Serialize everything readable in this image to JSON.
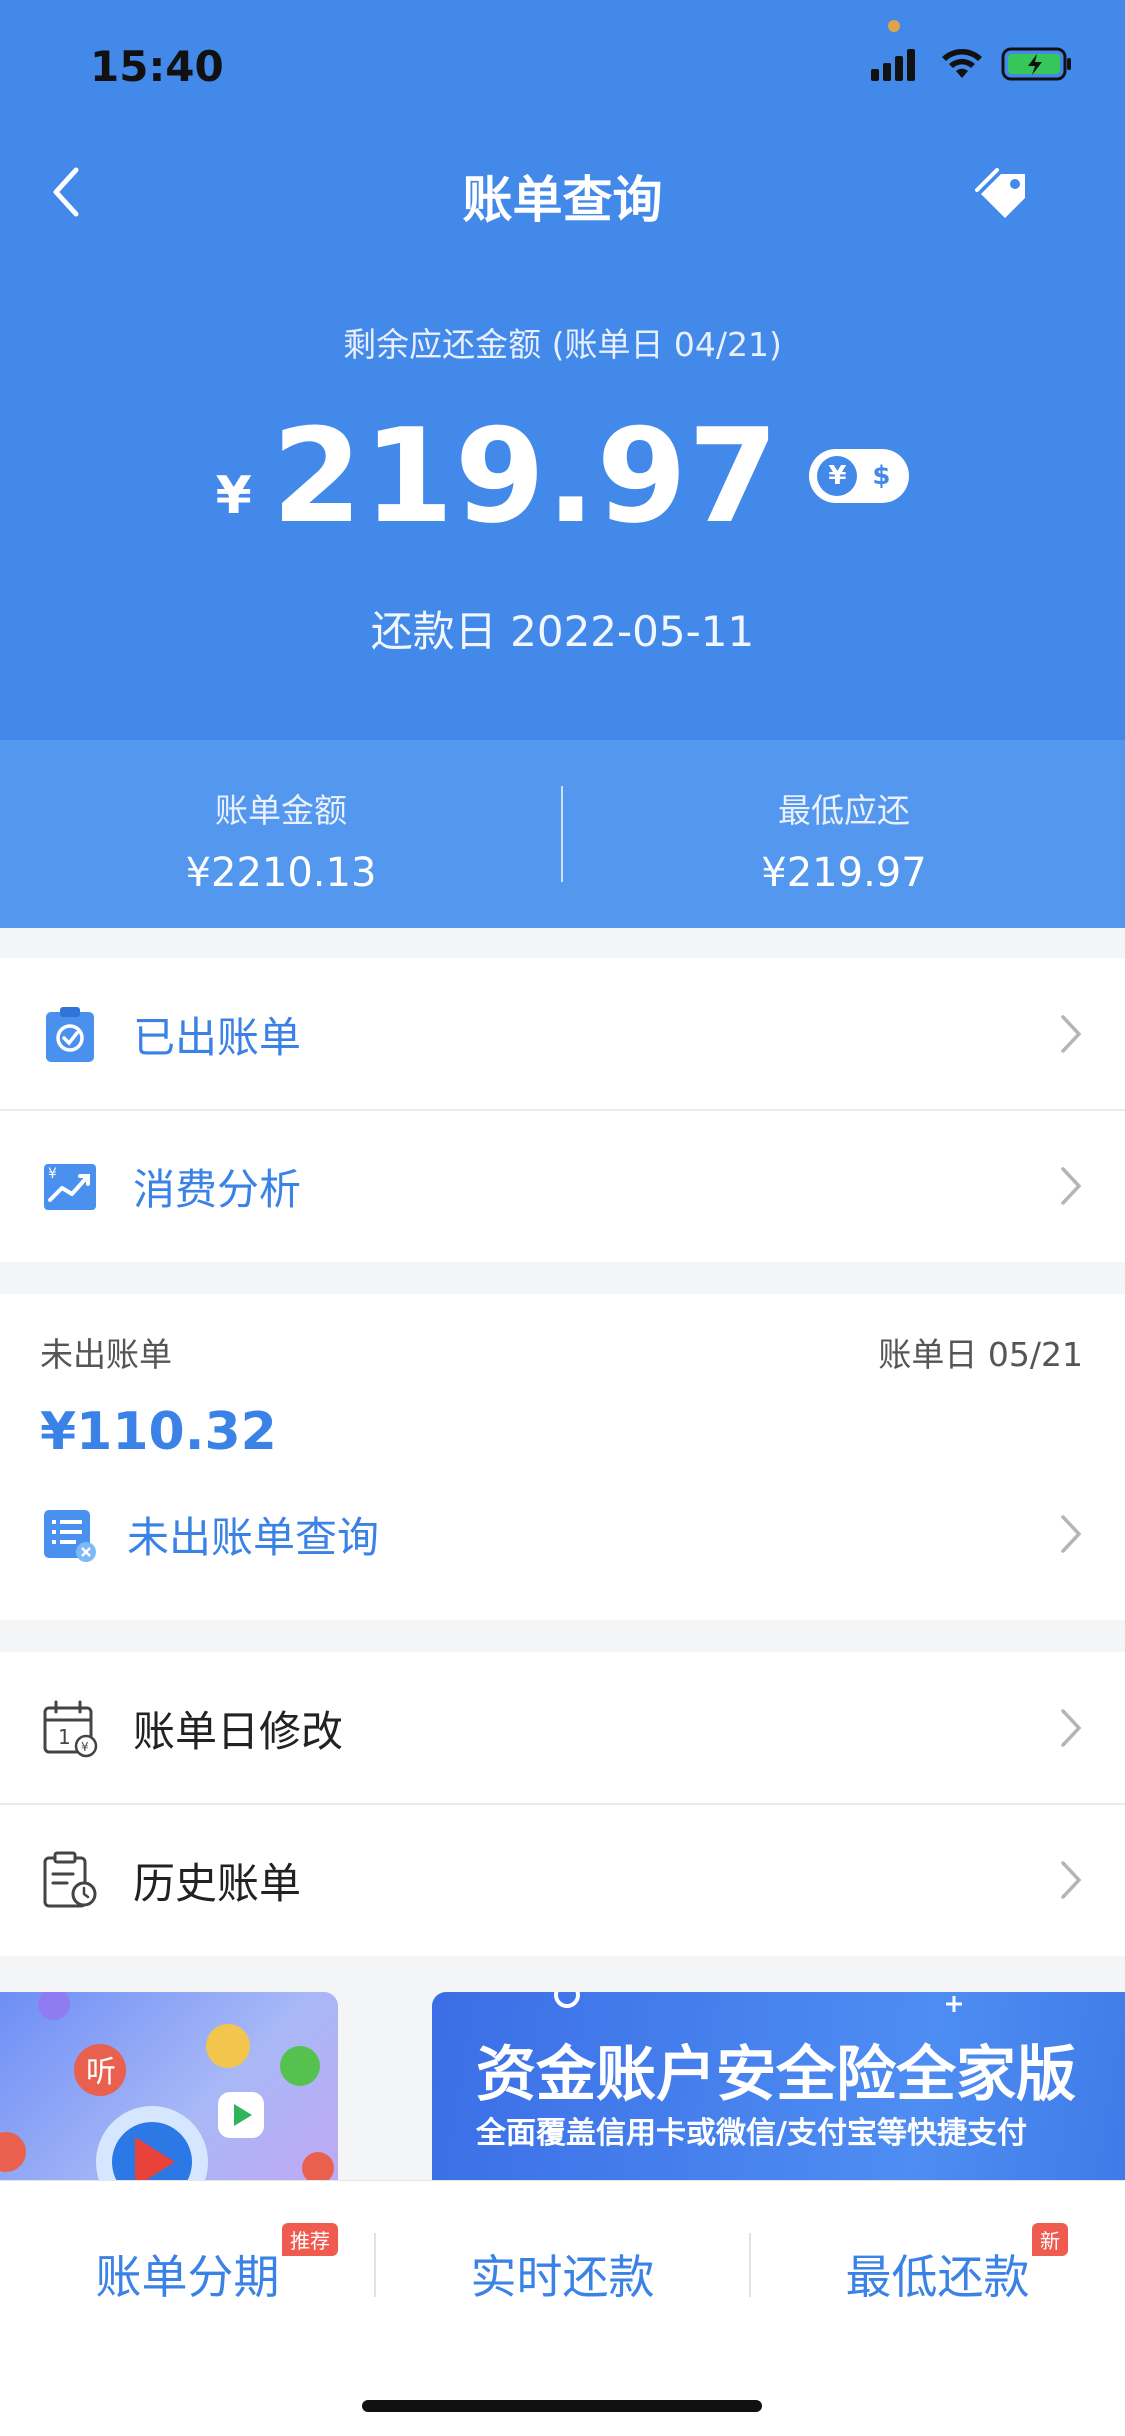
{
  "status_bar": {
    "time": "15:40"
  },
  "nav": {
    "title": "账单查询"
  },
  "header": {
    "subtitle": "剩余应还金额 (账单日 04/21)",
    "currency_symbol": "¥",
    "amount": "219.97",
    "toggle_yuan": "¥",
    "toggle_dollar": "$",
    "due_date": "还款日 2022-05-11"
  },
  "summary": {
    "bill_label": "账单金额",
    "bill_value": "¥2210.13",
    "min_label": "最低应还",
    "min_value": "¥219.97"
  },
  "menu1": [
    {
      "label": "已出账单",
      "icon": "clipboard-check-icon"
    },
    {
      "label": "消费分析",
      "icon": "chart-trend-icon"
    }
  ],
  "unbilled": {
    "label": "未出账单",
    "date": "账单日 05/21",
    "amount": "¥110.32",
    "query_label": "未出账单查询",
    "query_icon": "list-document-icon"
  },
  "menu2": [
    {
      "label": "账单日修改",
      "icon": "calendar-yen-icon"
    },
    {
      "label": "历史账单",
      "icon": "clipboard-clock-icon"
    }
  ],
  "banner": {
    "title": "资金账户安全险全家版",
    "subtitle": "全面覆盖信用卡或微信/支付宝等快捷支付",
    "app_badge": "听"
  },
  "bottom_tabs": [
    {
      "label": "账单分期",
      "badge": "推荐"
    },
    {
      "label": "实时还款",
      "badge": ""
    },
    {
      "label": "最低还款",
      "badge": "新"
    }
  ],
  "colors": {
    "primary": "#4389ea",
    "summary_bg": "#5497ef",
    "accent_text": "#3a82e6",
    "badge": "#f05b4f"
  }
}
